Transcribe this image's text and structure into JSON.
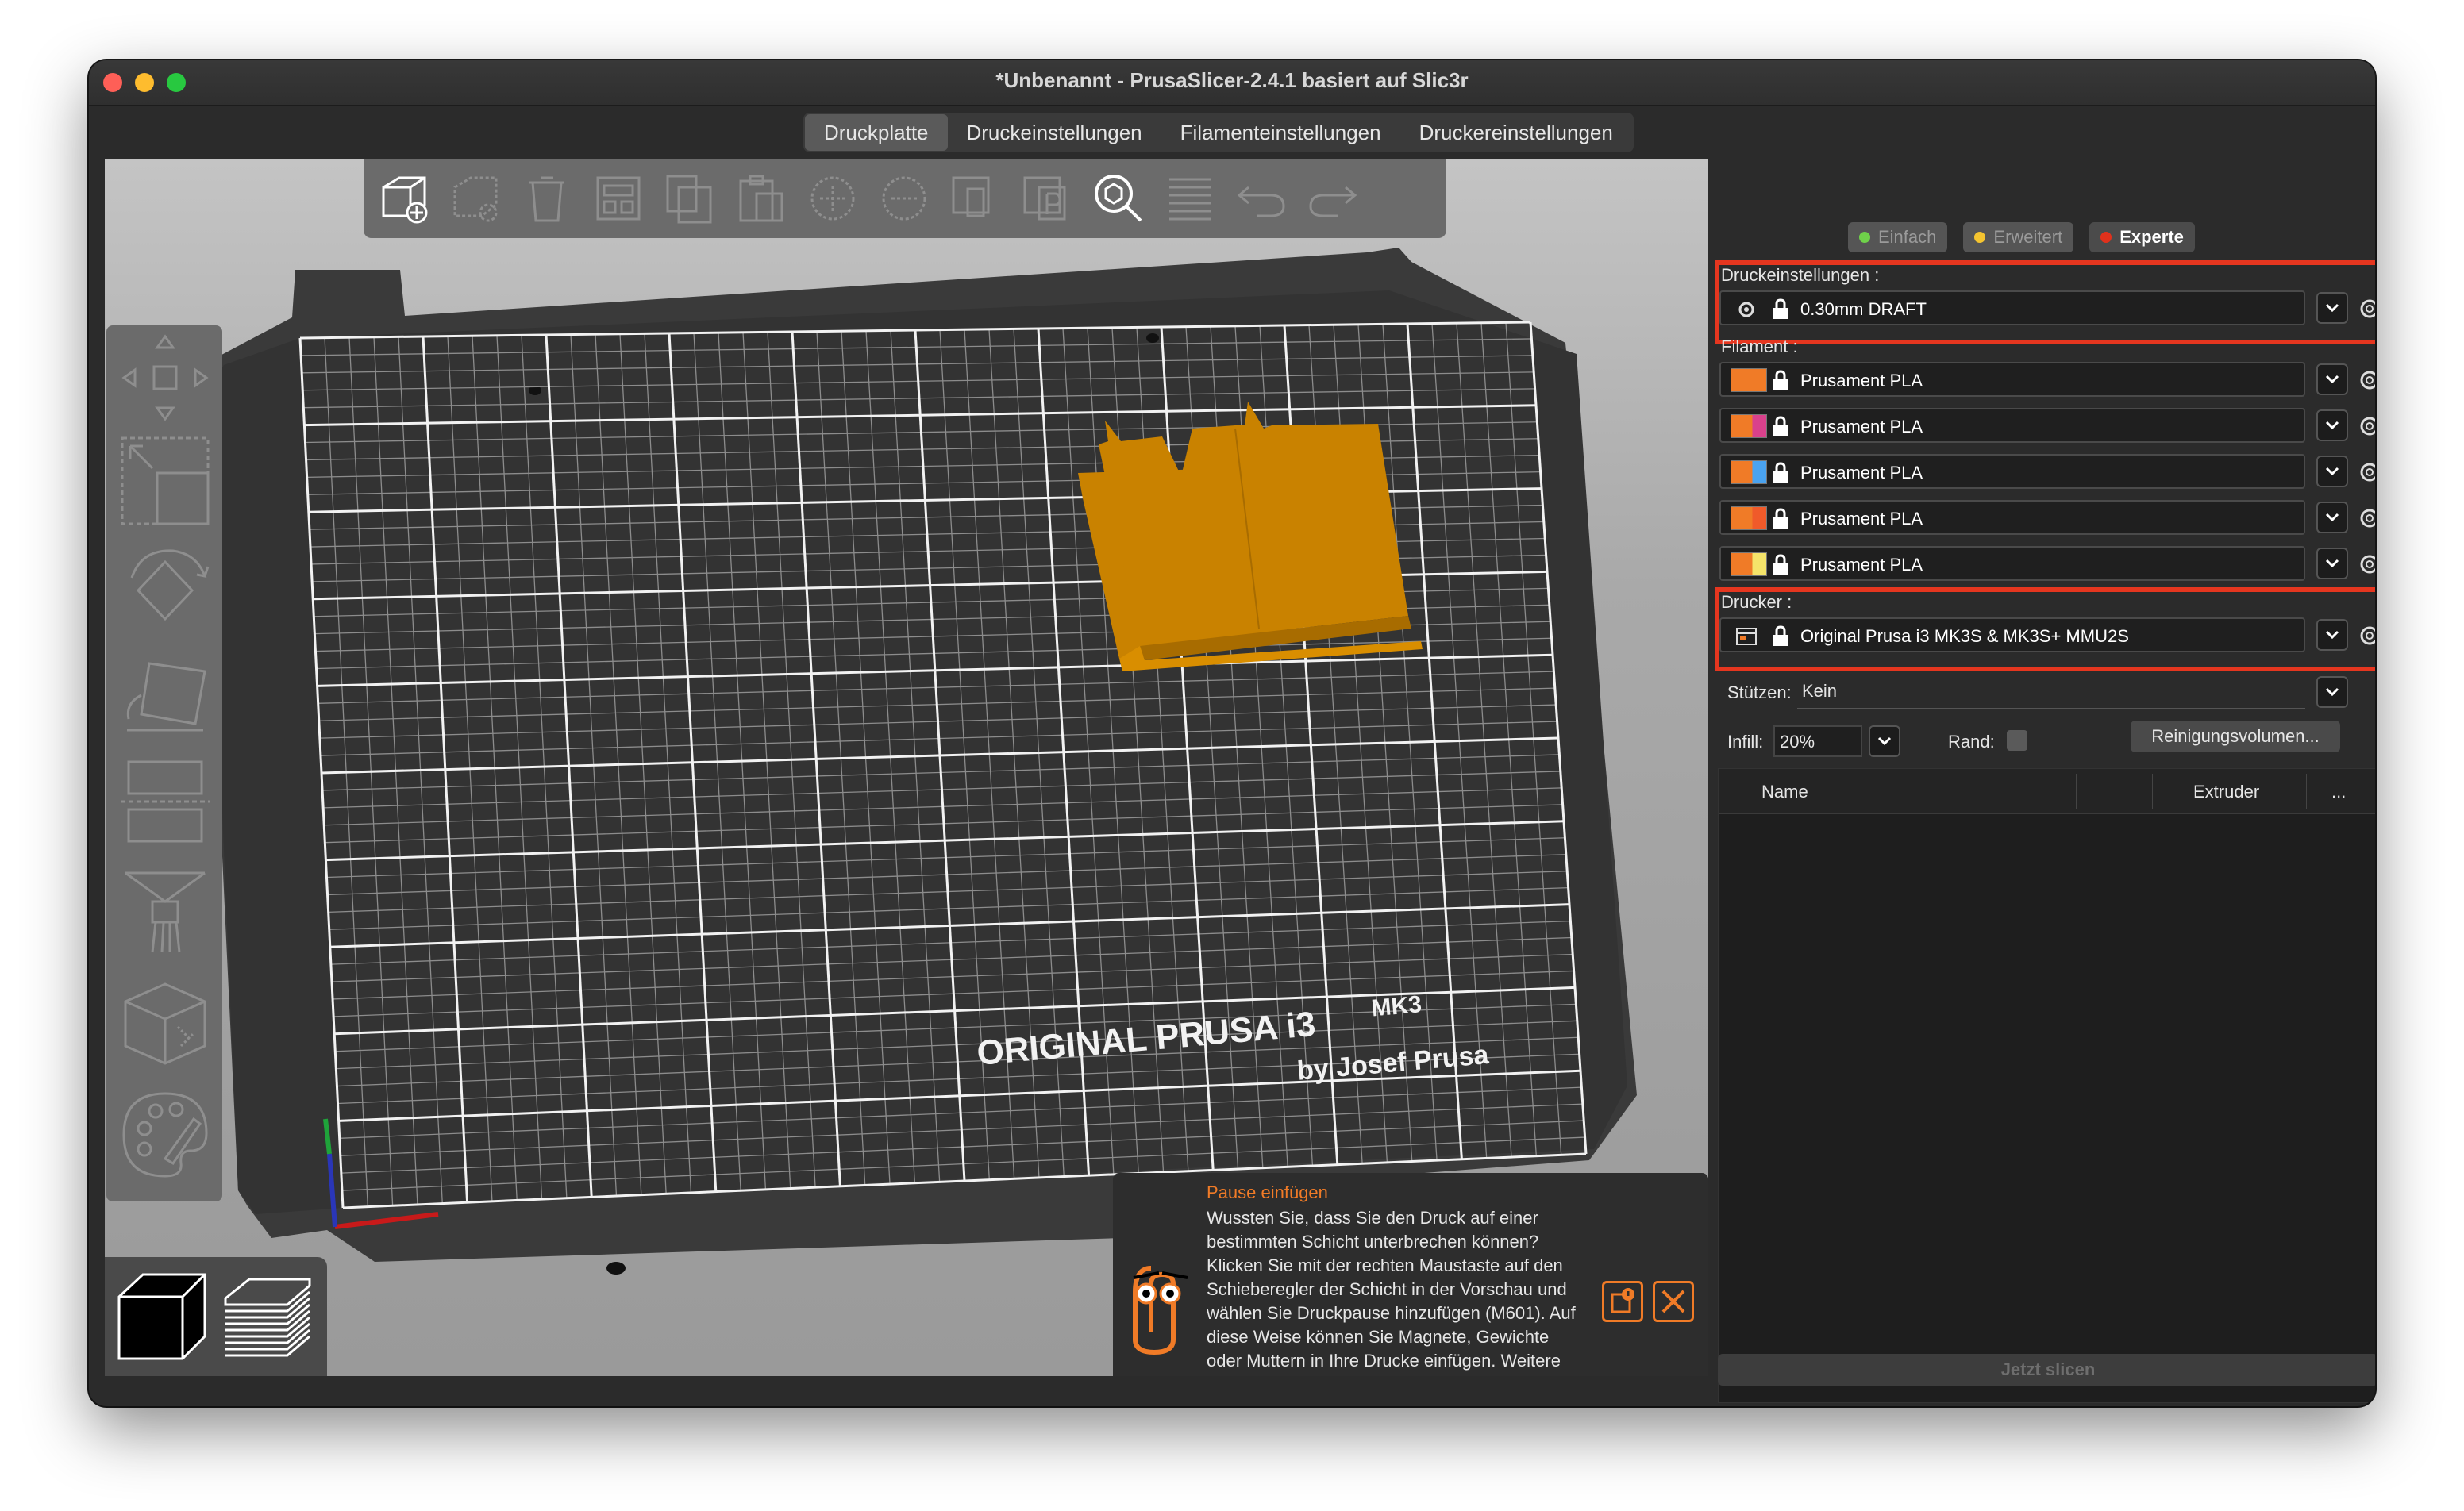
{
  "window": {
    "title": "*Unbenannt - PrusaSlicer-2.4.1 basiert auf Slic3r"
  },
  "tabs": [
    {
      "label": "Druckplatte",
      "active": true
    },
    {
      "label": "Druckeinstellungen",
      "active": false
    },
    {
      "label": "Filamenteinstellungen",
      "active": false
    },
    {
      "label": "Druckereinstellungen",
      "active": false
    }
  ],
  "toolbar_top": {
    "icons": [
      "add-object-icon",
      "delete-icon",
      "delete-all-icon",
      "arrange-icon",
      "copy-icon",
      "paste-icon",
      "add-instance-icon",
      "remove-instance-icon",
      "split-objects-icon",
      "split-parts-icon",
      "search-icon",
      "layer-editing-icon",
      "undo-icon",
      "redo-icon"
    ]
  },
  "toolbar_left": {
    "icons": [
      "move-icon",
      "scale-icon",
      "rotate-icon",
      "place-on-face-icon",
      "cut-icon",
      "paint-supports-icon",
      "seam-painting-icon",
      "mmu-painting-icon"
    ]
  },
  "view_toggle": {
    "icons": [
      "3d-view-icon",
      "preview-layers-icon"
    ]
  },
  "bed": {
    "brand_line1": "ORIGINAL PRUSA i3",
    "brand_model": "MK3",
    "brand_line2": "by Josef Prusa"
  },
  "tip": {
    "title": "Pause einfügen",
    "body": "Wussten Sie, dass Sie den Druck auf einer bestimmten Schicht unterbrechen können? Klicken Sie mit der rechten Maustaste auf den Schieberegler der Schicht in der Vorschau und wählen Sie Druckpause hinzufügen (M601). Auf diese Weise können Sie Magnete, Gewichte oder Muttern in Ihre Drucke einfügen. Weitere Informationen finden Sie in der Dokumentation."
  },
  "sidebar": {
    "modes": [
      {
        "label": "Einfach",
        "color": "#6fd14a",
        "active": false
      },
      {
        "label": "Erweitert",
        "color": "#f4c430",
        "active": false
      },
      {
        "label": "Experte",
        "color": "#e0311c",
        "active": true
      }
    ],
    "print_settings_label": "Druckeinstellungen :",
    "print_settings_value": "0.30mm DRAFT",
    "filament_label": "Filament :",
    "filaments": [
      {
        "name": "Prusament PLA",
        "swatch": "#f07b27",
        "accent": "#f07b27"
      },
      {
        "name": "Prusament PLA",
        "swatch": "#f07b27",
        "accent": "#d9418c"
      },
      {
        "name": "Prusament PLA",
        "swatch": "#f07b27",
        "accent": "#4aa3f0"
      },
      {
        "name": "Prusament PLA",
        "swatch": "#f07b27",
        "accent": "#f05a2a"
      },
      {
        "name": "Prusament PLA",
        "swatch": "#f07b27",
        "accent": "#f5e46a"
      }
    ],
    "printer_label": "Drucker :",
    "printer_value": "Original Prusa i3 MK3S & MK3S+ MMU2S",
    "supports_label": "Stützen:",
    "supports_value": "Kein",
    "infill_label": "Infill:",
    "infill_value": "20%",
    "brim_label": "Rand:",
    "purge_button": "Reinigungsvolumen...",
    "list_headers": {
      "name": "Name",
      "extruder": "Extruder",
      "more": "..."
    },
    "slice_button": "Jetzt slicen"
  },
  "colors": {
    "accent": "#f07b27",
    "highlight": "#e5361f",
    "object": "#c98200"
  }
}
